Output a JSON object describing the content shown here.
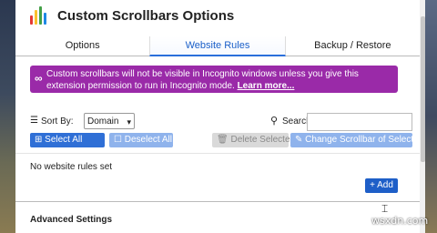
{
  "app": {
    "title": "Custom Scrollbars Options",
    "logo_colors": [
      "#e53935",
      "#fbc02d",
      "#43a047",
      "#1e88e5"
    ]
  },
  "tabs": [
    {
      "label": "Options",
      "active": false
    },
    {
      "label": "Website Rules",
      "active": true
    },
    {
      "label": "Backup / Restore",
      "active": false
    }
  ],
  "notice": {
    "text": "Custom scrollbars will not be visible in Incognito windows unless you give this extension permission to run in Incognito mode.",
    "link": "Learn more...",
    "color": "#9a2aa8"
  },
  "filters": {
    "sort_label": "Sort By:",
    "sort_value": "Domain",
    "search_label": "Search:",
    "search_value": ""
  },
  "buttons": {
    "select_all": "Select All",
    "deselect_all": "Deselect All",
    "delete_selected": "Delete Selected",
    "change_scrollbar": "Change Scrollbar of Selected",
    "add": "Add"
  },
  "rules": {
    "empty_message": "No website rules set",
    "items": []
  },
  "advanced": {
    "title": "Advanced Settings"
  },
  "watermark": "wsxdn.com"
}
